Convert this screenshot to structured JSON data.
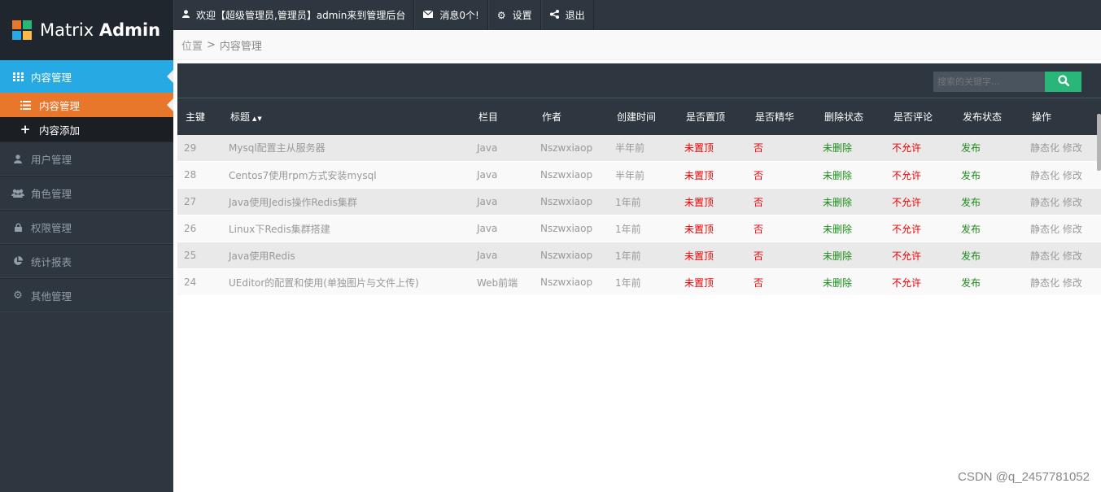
{
  "brand": {
    "part1": "Matrix",
    "part2": "Admin",
    "logo_colors": [
      "#e8762b",
      "#28b779",
      "#27a9e3",
      "#ffb848"
    ]
  },
  "topbar": {
    "welcome": "欢迎【超级管理员,管理员】admin来到管理后台",
    "messages": "消息0个!",
    "settings": "设置",
    "logout": "退出"
  },
  "breadcrumb": {
    "location": "位置",
    "separator": ">",
    "current": "内容管理"
  },
  "sidebar": {
    "active": {
      "label": "内容管理",
      "icon": "grid-icon"
    },
    "subitems": [
      {
        "label": "内容管理",
        "icon": "list-icon"
      },
      {
        "label": "内容添加",
        "icon": "plus-icon"
      }
    ],
    "items": [
      {
        "label": "用户管理",
        "icon": "user-icon"
      },
      {
        "label": "角色管理",
        "icon": "group-icon"
      },
      {
        "label": "权限管理",
        "icon": "lock-icon"
      },
      {
        "label": "统计报表",
        "icon": "pie-chart-icon"
      },
      {
        "label": "其他管理",
        "icon": "gear-icon"
      }
    ]
  },
  "search": {
    "placeholder": "搜索的关键字..."
  },
  "table": {
    "headers": [
      "主键",
      "标题",
      "栏目",
      "作者",
      "创建时间",
      "是否置顶",
      "是否精华",
      "删除状态",
      "是否评论",
      "发布状态",
      "操作"
    ],
    "rows": [
      {
        "id": "29",
        "title": "Mysql配置主从服务器",
        "column": "Java",
        "author": "Nszwxiaop",
        "time": "半年前",
        "top": "未置顶",
        "essence": "否",
        "deleted": "未删除",
        "comment": "不允许",
        "publish": "发布",
        "op1": "静态化",
        "op2": "修改"
      },
      {
        "id": "28",
        "title": "Centos7使用rpm方式安装mysql",
        "column": "Java",
        "author": "Nszwxiaop",
        "time": "半年前",
        "top": "未置顶",
        "essence": "否",
        "deleted": "未删除",
        "comment": "不允许",
        "publish": "发布",
        "op1": "静态化",
        "op2": "修改"
      },
      {
        "id": "27",
        "title": "Java使用Jedis操作Redis集群",
        "column": "Java",
        "author": "Nszwxiaop",
        "time": "1年前",
        "top": "未置顶",
        "essence": "否",
        "deleted": "未删除",
        "comment": "不允许",
        "publish": "发布",
        "op1": "静态化",
        "op2": "修改"
      },
      {
        "id": "26",
        "title": "Linux下Redis集群搭建",
        "column": "Java",
        "author": "Nszwxiaop",
        "time": "1年前",
        "top": "未置顶",
        "essence": "否",
        "deleted": "未删除",
        "comment": "不允许",
        "publish": "发布",
        "op1": "静态化",
        "op2": "修改"
      },
      {
        "id": "25",
        "title": "Java使用Redis",
        "column": "Java",
        "author": "Nszwxiaop",
        "time": "1年前",
        "top": "未置顶",
        "essence": "否",
        "deleted": "未删除",
        "comment": "不允许",
        "publish": "发布",
        "op1": "静态化",
        "op2": "修改"
      },
      {
        "id": "24",
        "title": "UEditor的配置和使用(单独图片与文件上传)",
        "column": "Web前端",
        "author": "Nszwxiaop",
        "time": "1年前",
        "top": "未置顶",
        "essence": "否",
        "deleted": "未删除",
        "comment": "不允许",
        "publish": "发布",
        "op1": "静态化",
        "op2": "修改"
      }
    ]
  },
  "watermark": "CSDN @q_2457781052"
}
